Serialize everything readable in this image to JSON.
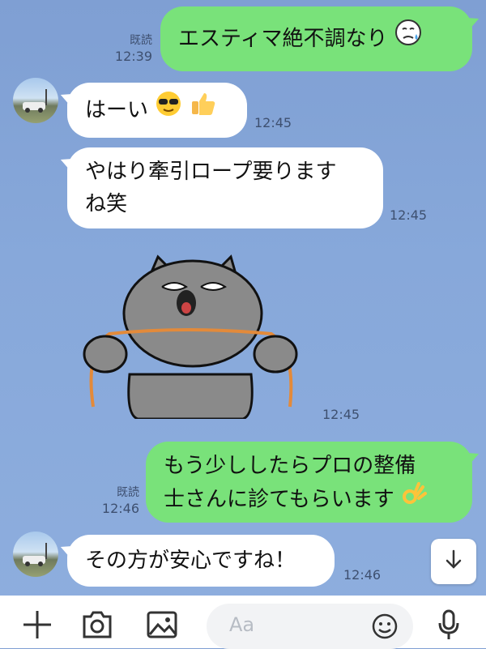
{
  "messages": [
    {
      "dir": "out",
      "text": "エスティマ絶不調なり",
      "emoji": "sweat-face-emoji",
      "status": "既読",
      "time": "12:39"
    },
    {
      "dir": "in",
      "text": "はーい",
      "emojis": [
        "sunglasses-emoji",
        "thumbs-up-emoji"
      ],
      "time": "12:45"
    },
    {
      "dir": "in",
      "text_lines": [
        "やはり牽引ロープ要ります",
        "ね笑"
      ],
      "time": "12:45"
    },
    {
      "dir": "in",
      "type": "sticker",
      "sticker": "gray-cat-holding-rope",
      "time": "12:45"
    },
    {
      "dir": "out",
      "text_lines": [
        "もう少ししたらプロの整備",
        "士さんに診てもらいます"
      ],
      "emoji": "ok-hand-emoji",
      "status": "既読",
      "time": "12:46"
    },
    {
      "dir": "in",
      "text": "その方が安心ですね！",
      "time": "12:46"
    }
  ],
  "composer": {
    "placeholder": "Aa",
    "icons": [
      "plus-icon",
      "camera-icon",
      "image-icon",
      "emoji-icon",
      "mic-icon"
    ]
  },
  "scroll_button_icon": "arrow-down-icon",
  "colors": {
    "outgoing": "#79e27a",
    "incoming": "#ffffff",
    "background": "#87a8da"
  }
}
